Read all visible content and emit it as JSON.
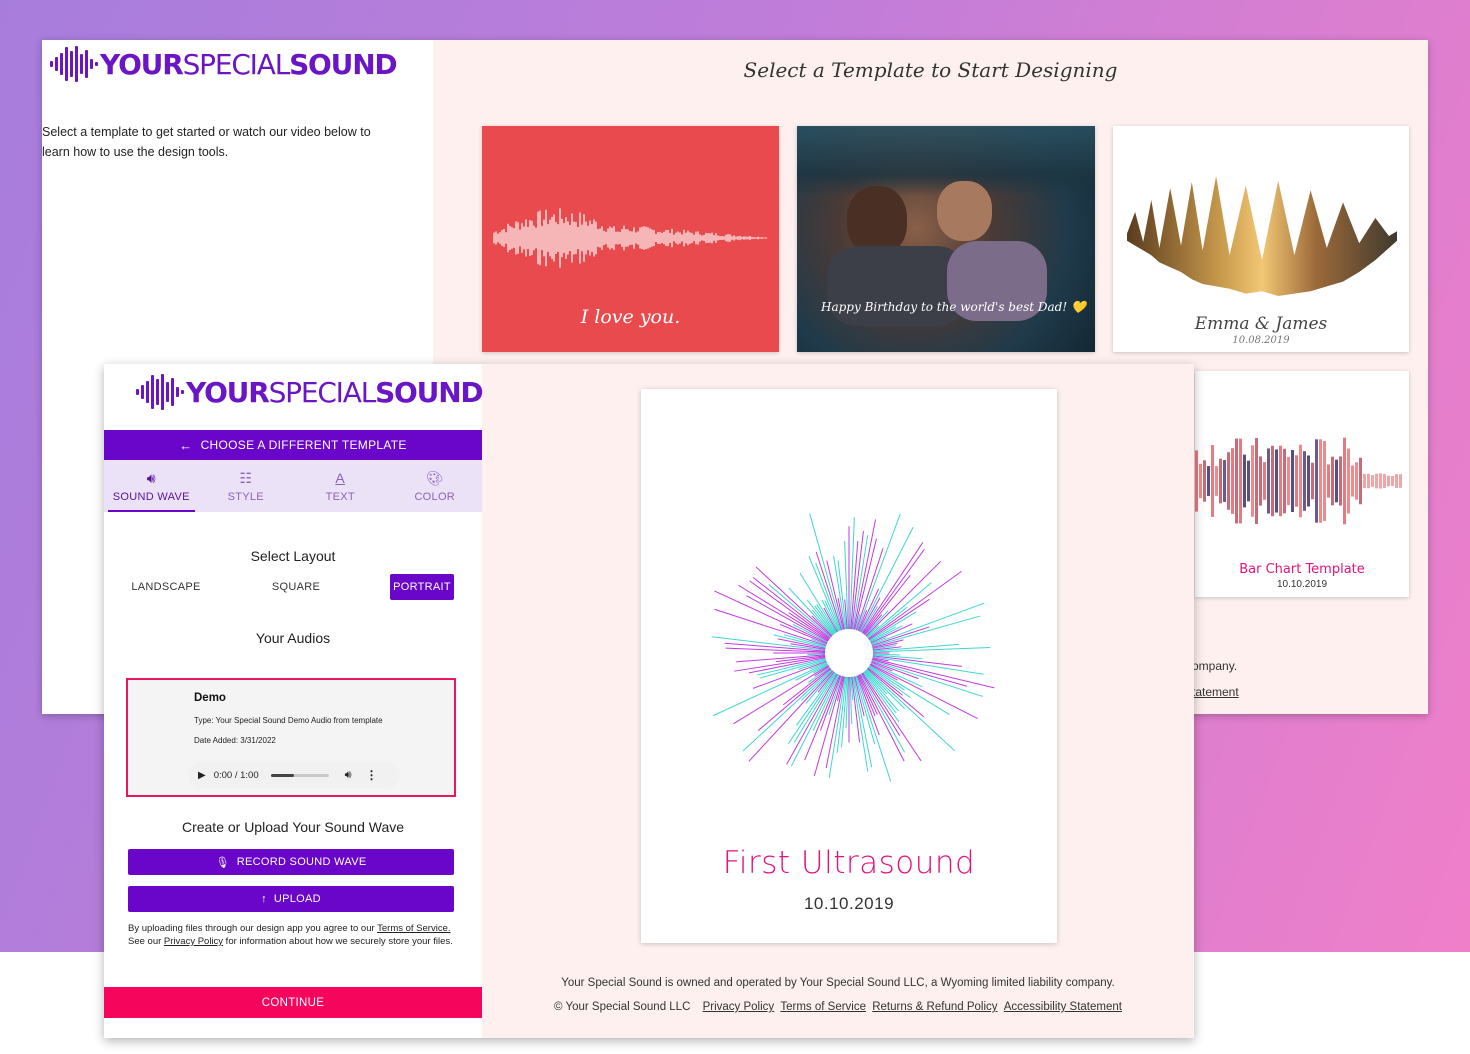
{
  "brand": {
    "word_a": "YOUR",
    "word_b": "SPECIAL",
    "word_c": "SOUND",
    "color": "#6a16c6"
  },
  "back_window": {
    "intro_text": "Select a template to get started or watch our video below to learn how to use the design tools.",
    "heading": "Select a Template to Start Designing",
    "templates": [
      {
        "caption": "I love you."
      },
      {
        "caption": "Happy Birthday to the world's best Dad! 💛"
      },
      {
        "caption": "Emma & James",
        "date": "10.08.2019"
      },
      {
        "caption": "Bar Chart Template",
        "date": "10.10.2019"
      }
    ],
    "footer_fragment_1": "ompany.",
    "footer_fragment_2": "tatement"
  },
  "editor": {
    "choose_button": "CHOOSE A DIFFERENT TEMPLATE",
    "tabs": [
      {
        "label": "SOUND WAVE",
        "icon": "volume-icon"
      },
      {
        "label": "STYLE",
        "icon": "sliders-icon"
      },
      {
        "label": "TEXT",
        "icon": "text-icon"
      },
      {
        "label": "COLOR",
        "icon": "palette-icon"
      }
    ],
    "select_layout_title": "Select Layout",
    "layouts": [
      "LANDSCAPE",
      "SQUARE",
      "PORTRAIT"
    ],
    "selected_layout": "PORTRAIT",
    "your_audios_title": "Your Audios",
    "audio": {
      "name": "Demo",
      "type": "Type: Your Special Sound Demo Audio from template",
      "date_added": "Date Added: 3/31/2022",
      "time": "0:00 / 1:00",
      "progress": 0.4
    },
    "create_title": "Create or Upload Your Sound Wave",
    "record_button": "RECORD SOUND WAVE",
    "upload_button": "UPLOAD",
    "legal_1": "By uploading files through our design app you agree to our ",
    "legal_terms": "Terms of Service.",
    "legal_2": "See our ",
    "legal_privacy": "Privacy Policy",
    "legal_3": " for information about how we securely store your files.",
    "continue_button": "CONTINUE"
  },
  "preview": {
    "title": "First Ultrasound",
    "date": "10.10.2019",
    "colors": {
      "title": "#e4127a",
      "ray_a": "#c23ae0",
      "ray_b": "#3fd6cf"
    }
  },
  "footer": {
    "line1": "Your Special Sound is owned and operated by Your Special Sound LLC, a Wyoming limited liability company.",
    "copyright": "© Your Special Sound LLC",
    "links": [
      "Privacy Policy",
      "Terms of Service",
      "Returns & Refund Policy",
      "Accessibility Statement"
    ]
  },
  "colors": {
    "accent": "#6a06c9",
    "continue": "#f5065c",
    "audio_border": "#e8175f",
    "background_panel": "#fdf0ef"
  }
}
